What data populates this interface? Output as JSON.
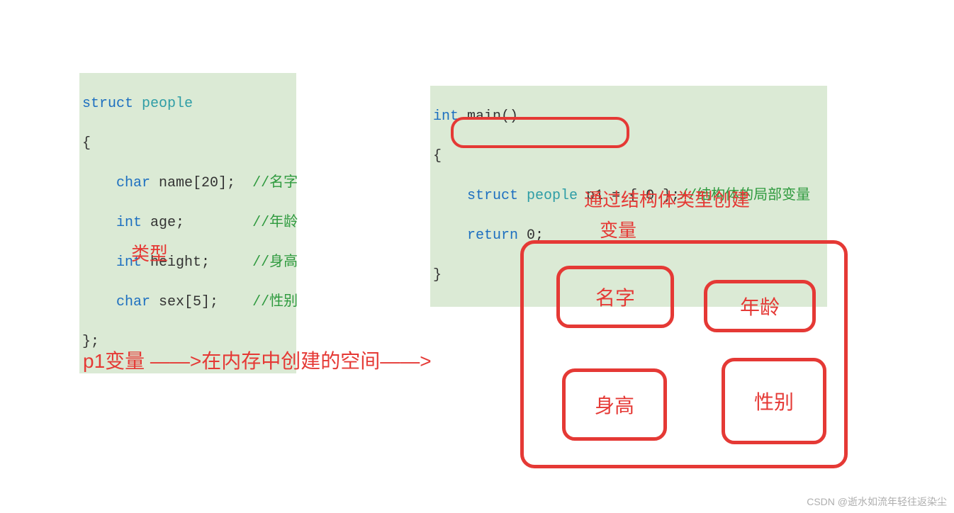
{
  "code_left": {
    "struct_kw": "struct",
    "struct_name": "people",
    "open_brace": "{",
    "line1_type": "char",
    "line1_rest": " name[20];",
    "line1_pad": "  ",
    "line1_comment": "//名字",
    "line2_type": "int",
    "line2_rest": " age;",
    "line2_pad": "        ",
    "line2_comment": "//年龄",
    "line3_type": "int",
    "line3_rest": " height;",
    "line3_pad": "     ",
    "line3_comment": "//身高",
    "line4_type": "char",
    "line4_rest": " sex[5];",
    "line4_pad": "    ",
    "line4_comment": "//性别",
    "close_brace": "};"
  },
  "code_right": {
    "int_kw": "int",
    "main_rest": " main()",
    "open_brace": "{",
    "indent": "    ",
    "struct_kw": "struct",
    "struct_name": "people",
    "var_rest": " p1 = { 0 };",
    "var_comment": "//结构体的局部变量",
    "return_kw": "return",
    "return_rest": " 0;",
    "close_brace": "}"
  },
  "labels": {
    "type": "类型",
    "create_line1": "通过结构体类型创建",
    "create_line2": "变量",
    "p1_arrow": "p1变量 ——>在内存中创建的空间——>"
  },
  "memory": {
    "name": "名字",
    "age": "年龄",
    "height": "身高",
    "sex": "性别"
  },
  "watermark": "CSDN @逝水如流年轻往返染尘"
}
